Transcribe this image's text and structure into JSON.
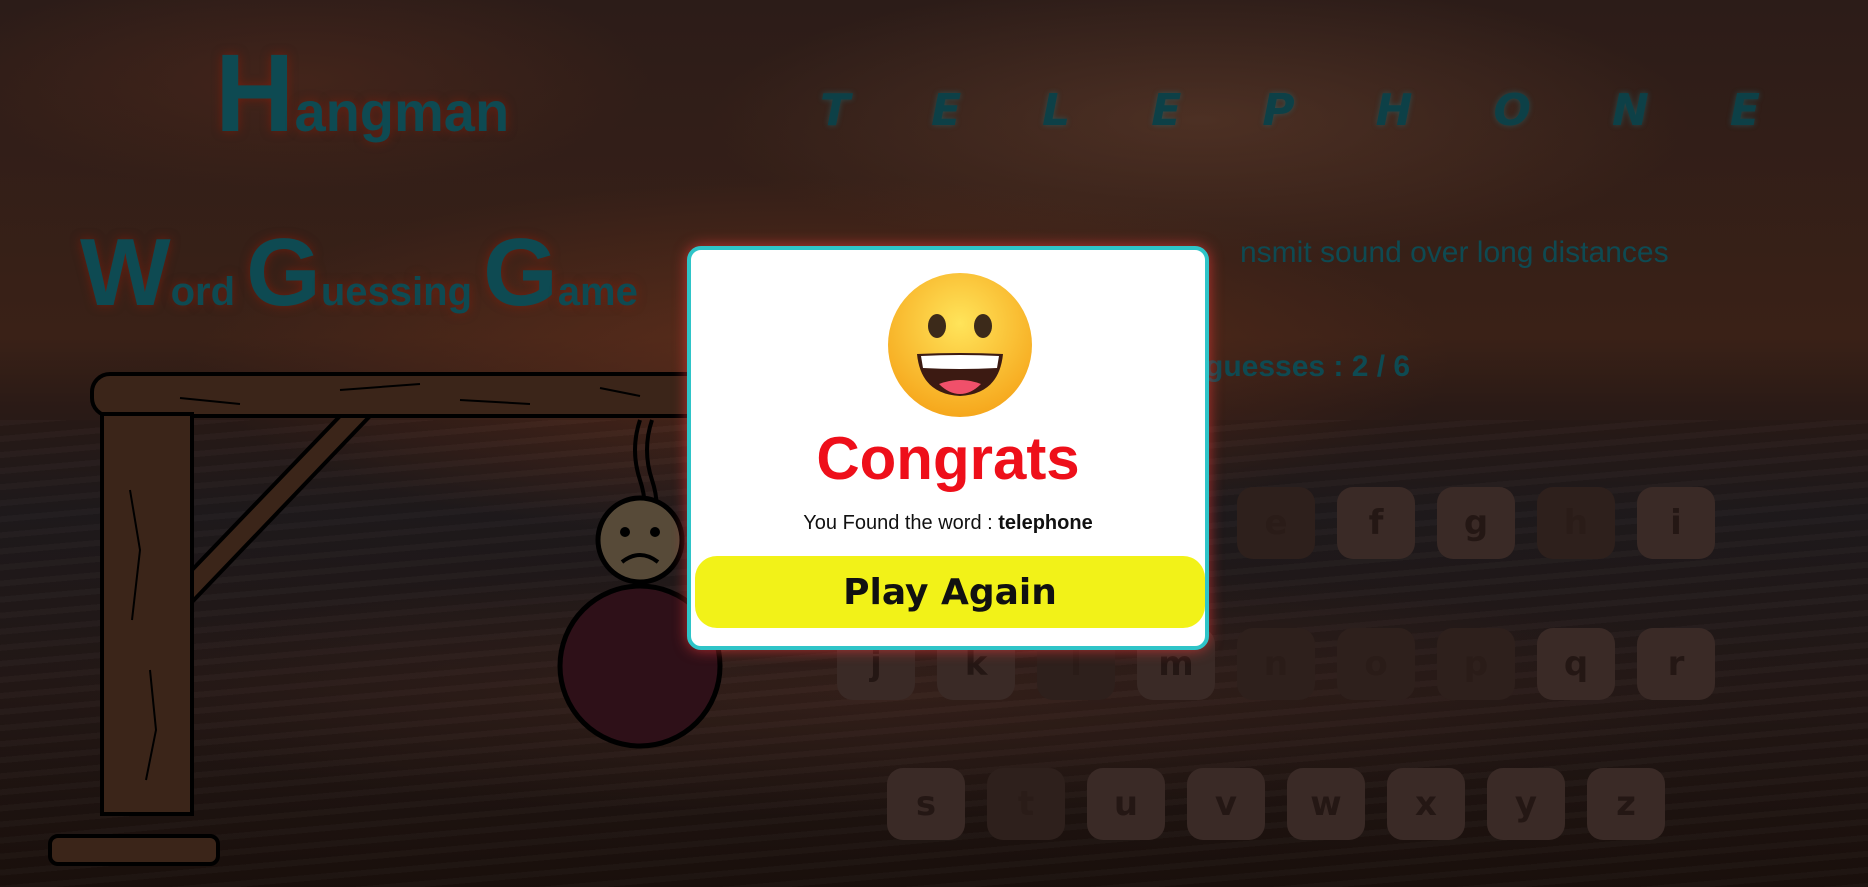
{
  "title": {
    "first_letter": "H",
    "rest": "angman"
  },
  "subtitle": [
    {
      "first_letter": "W",
      "rest": "ord"
    },
    {
      "first_letter": "G",
      "rest": "uessing"
    },
    {
      "first_letter": "G",
      "rest": "ame"
    }
  ],
  "word_letters": [
    "T",
    "E",
    "L",
    "E",
    "P",
    "H",
    "O",
    "N",
    "E"
  ],
  "hint_text": "nsmit sound over long distances",
  "guesses_text": "guesses : 2 / 6",
  "keyboard": {
    "row1": [
      "e",
      "f",
      "g",
      "h",
      "i"
    ],
    "row2": [
      "j",
      "k",
      "l",
      "m",
      "n",
      "o",
      "p",
      "q",
      "r"
    ],
    "row3": [
      "s",
      "t",
      "u",
      "v",
      "w",
      "x",
      "y",
      "z"
    ],
    "used_keys": [
      "e",
      "h",
      "l",
      "n",
      "o",
      "p",
      "t"
    ]
  },
  "modal": {
    "emoji": "grinning-face",
    "heading": "Congrats",
    "message_prefix": "You Found the word : ",
    "found_word": "telephone",
    "button_label": "Play Again"
  },
  "colors": {
    "title_teal": "#0e4a52",
    "modal_border": "#2ec4c8",
    "congrats_red": "#ee0f1a",
    "button_yellow": "#f2f218"
  }
}
